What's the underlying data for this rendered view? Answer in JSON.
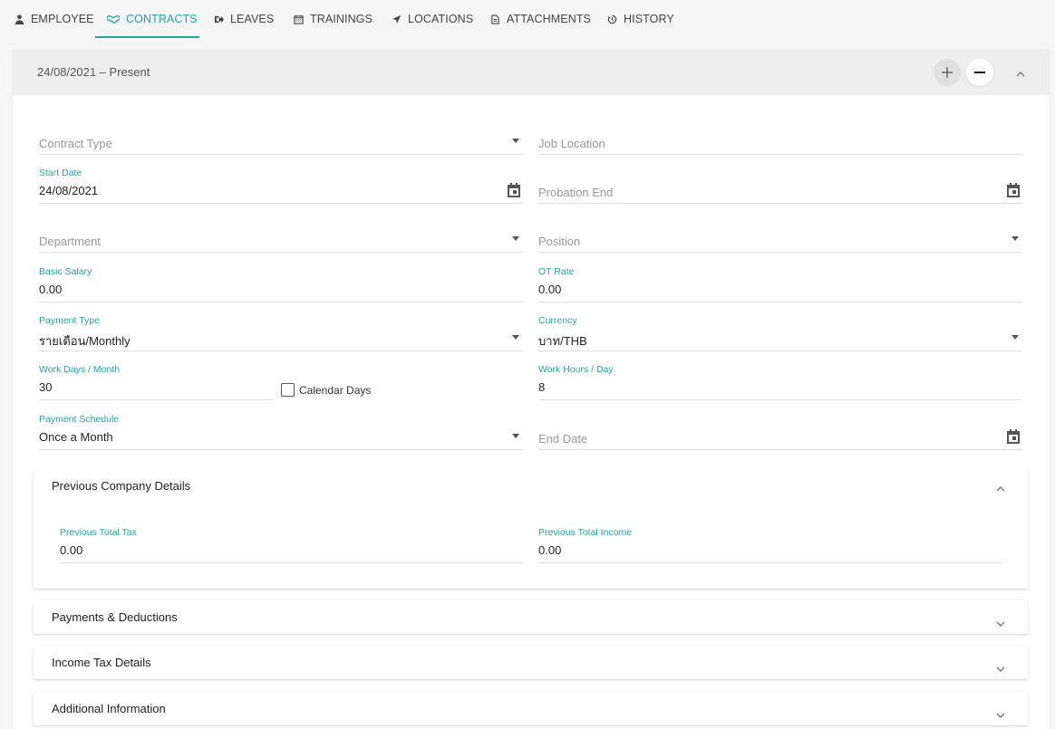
{
  "tabs": [
    {
      "label": "EMPLOYEE",
      "icon": "person-icon"
    },
    {
      "label": "CONTRACTS",
      "icon": "handshake-icon",
      "active": true
    },
    {
      "label": "LEAVES",
      "icon": "exit-icon"
    },
    {
      "label": "TRAININGS",
      "icon": "calendar-icon"
    },
    {
      "label": "LOCATIONS",
      "icon": "location-arrow-icon"
    },
    {
      "label": "ATTACHMENTS",
      "icon": "file-icon"
    },
    {
      "label": "HISTORY",
      "icon": "history-icon"
    }
  ],
  "contract": {
    "period": "24/08/2021 – Present"
  },
  "form": {
    "contract_type": {
      "placeholder": "Contract Type"
    },
    "job_location": {
      "placeholder": "Job Location"
    },
    "start_date": {
      "label": "Start Date",
      "value": "24/08/2021"
    },
    "probation_end": {
      "placeholder": "Probation End"
    },
    "department": {
      "placeholder": "Department"
    },
    "position": {
      "placeholder": "Position"
    },
    "basic_salary": {
      "label": "Basic Salary",
      "value": "0.00"
    },
    "ot_rate": {
      "label": "OT Rate",
      "value": "0.00"
    },
    "payment_type": {
      "label": "Payment Type",
      "value": "รายเดือน/Monthly"
    },
    "currency": {
      "label": "Currency",
      "value": "บาท/THB"
    },
    "work_days": {
      "label": "Work Days / Month",
      "value": "30"
    },
    "calendar_days": {
      "label": "Calendar Days",
      "checked": false
    },
    "work_hours": {
      "label": "Work Hours / Day",
      "value": "8"
    },
    "payment_schedule": {
      "label": "Payment Schedule",
      "value": "Once a Month"
    },
    "end_date": {
      "placeholder": "End Date"
    }
  },
  "previous_company": {
    "title": "Previous Company Details",
    "total_tax": {
      "label": "Previous Total Tax",
      "value": "0.00"
    },
    "total_income": {
      "label": "Previous Total Income",
      "value": "0.00"
    }
  },
  "panels": {
    "payments": "Payments & Deductions",
    "income_tax": "Income Tax Details",
    "additional": "Additional Information"
  },
  "colors": {
    "accent": "#26a69a",
    "background": "#f5f5f5",
    "header": "#eeeeee"
  }
}
